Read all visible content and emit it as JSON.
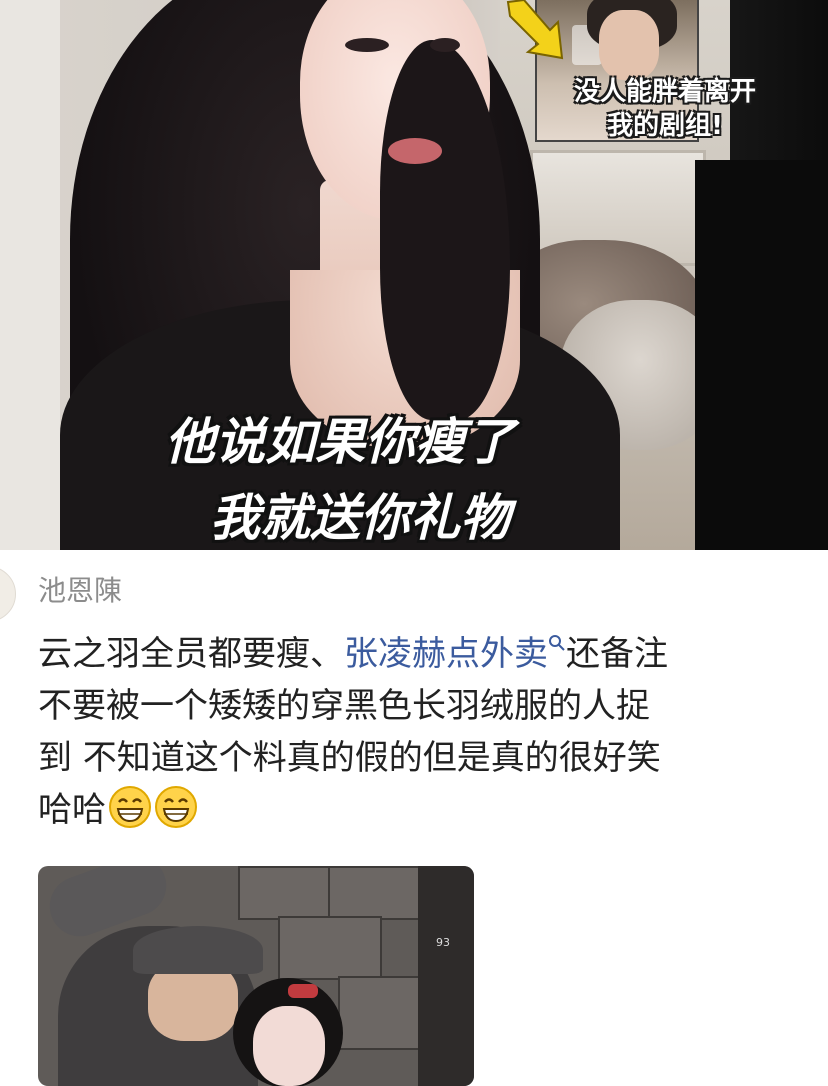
{
  "video": {
    "subtitle_line1": "他说如果你瘦了",
    "subtitle_line2": "我就送你礼物",
    "inset_caption_line1": "没人能胖着离开",
    "inset_caption_line2": "我的剧组!"
  },
  "comment": {
    "username": "池恩陳",
    "text_part1": "云之羽全员都要瘦、",
    "link_text": "张凌赫点外卖",
    "text_part2": "还备注",
    "line2": "不要被一个矮矮的穿黑色长羽绒服的人捉",
    "line3": "到 不知道这个料真的假的但是真的很好笑",
    "line4": "哈哈",
    "emojis": [
      "grinning-emoji",
      "grinning-emoji"
    ]
  },
  "photo": {
    "tag_text": "93"
  },
  "colors": {
    "link": "#3b5b9e",
    "username": "#8c8c8c",
    "text": "#222222",
    "subtitle_stroke": "#111111"
  }
}
